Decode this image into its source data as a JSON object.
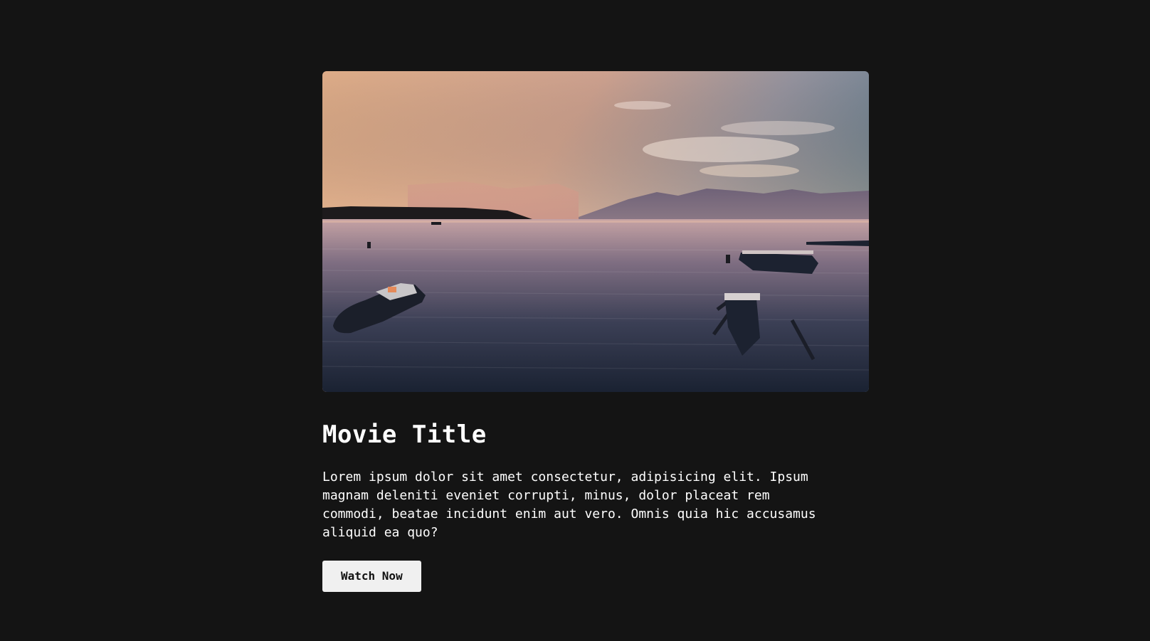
{
  "movie": {
    "title": "Movie Title",
    "description": "Lorem ipsum dolor sit amet consectetur, adipisicing elit. Ipsum magnam deleniti eveniet corrupti, minus, dolor placeat rem commodi, beatae incidunt enim aut vero. Omnis quia hic accusamus aliquid ea quo?",
    "watch_label": "Watch Now"
  },
  "colors": {
    "background": "#141414",
    "button_bg": "#f0f0f0",
    "button_text": "#111111",
    "text": "#ffffff"
  }
}
